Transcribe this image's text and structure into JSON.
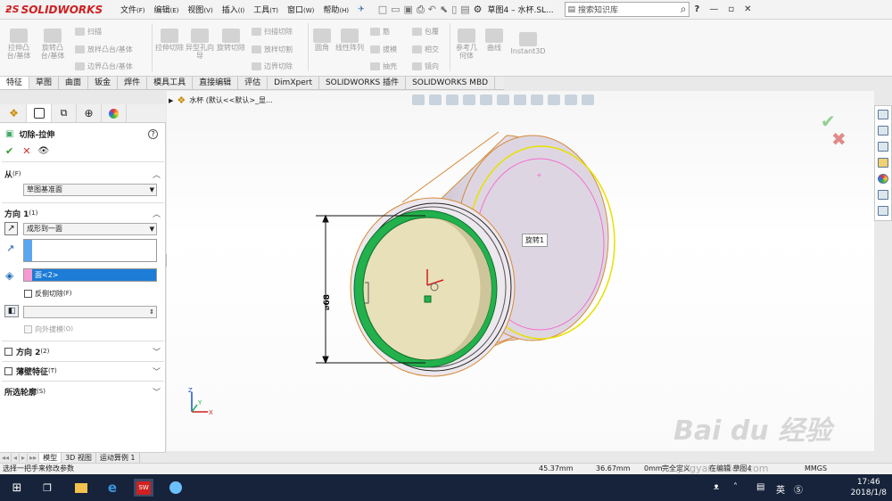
{
  "app": {
    "logo_text": "SOLIDWORKS",
    "menu": [
      {
        "label": "文件",
        "key": "(F)"
      },
      {
        "label": "编辑",
        "key": "(E)"
      },
      {
        "label": "视图",
        "key": "(V)"
      },
      {
        "label": "插入",
        "key": "(I)"
      },
      {
        "label": "工具",
        "key": "(T)"
      },
      {
        "label": "窗口",
        "key": "(W)"
      },
      {
        "label": "帮助",
        "key": "(H)"
      }
    ],
    "doc_title": "草图4 – 水杯.SL...",
    "search_placeholder": "搜索知识库"
  },
  "ribbon": {
    "big": [
      "拉伸凸台/基体",
      "旋转凸台/基体",
      "拉伸切除",
      "异型孔向导",
      "旋转切除",
      "圆角",
      "线性阵列",
      "参考几何体",
      "曲线",
      "Instant3D"
    ],
    "small": [
      "扫描",
      "放样凸台/基体",
      "边界凸台/基体",
      "扫描切除",
      "放样切割",
      "边界切除",
      "筋",
      "拔模",
      "抽壳",
      "包覆",
      "相交",
      "镜向"
    ]
  },
  "tabs": [
    "特征",
    "草图",
    "曲面",
    "钣金",
    "焊件",
    "模具工具",
    "直接编辑",
    "评估",
    "DimXpert",
    "SOLIDWORKS 插件",
    "SOLIDWORKS MBD"
  ],
  "panel": {
    "title": "切除-拉伸",
    "from_label": "从",
    "from_key": "(F)",
    "from_value": "草图基准面",
    "dir1_label": "方向 1",
    "dir1_key": "(1)",
    "end_condition": "成形到一面",
    "face_value": "面<2>",
    "reverse_label": "反侧切除",
    "reverse_key": "(F)",
    "draft_label": "向外拔模",
    "draft_key": "(O)",
    "dir2_label": "方向 2",
    "dir2_key": "(2)",
    "thin_label": "薄壁特征",
    "thin_key": "(T)",
    "contours_label": "所选轮廓",
    "contours_key": "(S)"
  },
  "viewport": {
    "breadcrumb": "水杯 (默认<<默认>_显...",
    "dimension": "⌀68",
    "tooltip": "旋转1",
    "triad": {
      "x": "X",
      "y": "Y",
      "z": "Z"
    }
  },
  "bottom_tabs": [
    "模型",
    "3D 视图",
    "运动算例 1"
  ],
  "status": {
    "hint": "选择一把手来修改参数",
    "x": "45.37mm",
    "y": "36.67mm",
    "z": "0mm",
    "state": "完全定义",
    "editing": "在编辑 草图4",
    "units": "MMGS"
  },
  "taskbar": {
    "ime": "英",
    "time": "17:46",
    "date": "2018/1/8"
  },
  "watermark": {
    "brand": "Bai du 经验",
    "url": "jingyan.baidu.com"
  },
  "colors": {
    "accept": "#2e9b2e",
    "cancel": "#d03030",
    "selection": "#1c7cd6",
    "face_pink": "#f79ad2",
    "shell_green": "#22b14c",
    "taskbar": "#16233a"
  }
}
